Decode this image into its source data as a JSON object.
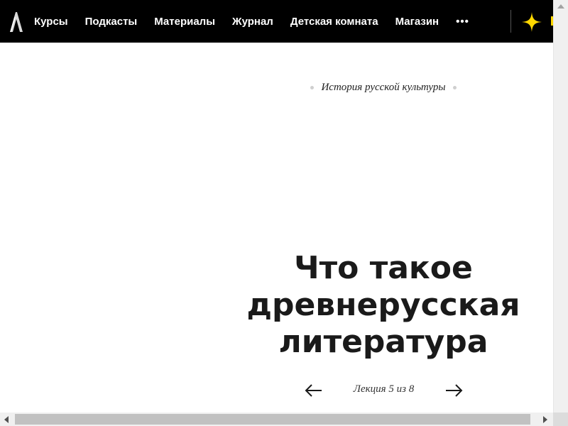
{
  "header": {
    "logo_icon": "arzamas-a-logo-icon",
    "nav_items": [
      {
        "label": "Курсы"
      },
      {
        "label": "Подкасты"
      },
      {
        "label": "Материалы"
      },
      {
        "label": "Журнал"
      },
      {
        "label": "Детская комната"
      },
      {
        "label": "Магазин"
      }
    ],
    "more_label": "•••",
    "spark_icon": "sparkle-icon",
    "accent_color": "#ffd800"
  },
  "main": {
    "course_label": "История русской культуры",
    "title": "Что такое древнерусская литература",
    "lecture_counter": "Лекция 5 из 8",
    "prev_icon": "arrow-left-icon",
    "next_icon": "arrow-right-icon"
  },
  "colors": {
    "nav_background": "#000000",
    "title_text": "#1a1a1a",
    "dot": "#cfcfcf"
  }
}
